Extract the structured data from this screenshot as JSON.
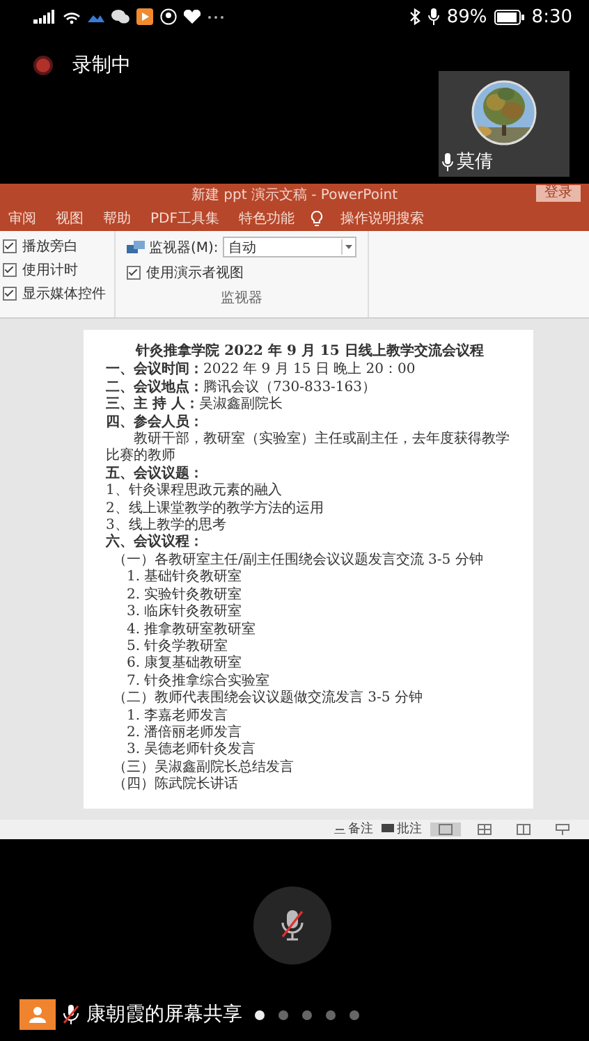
{
  "status_bar": {
    "battery": "89%",
    "time": "8:30"
  },
  "recording": {
    "label": "录制中",
    "on": true
  },
  "participant": {
    "name": "莫倩",
    "mic_on": true
  },
  "shared_screen": {
    "window_title": "新建 ppt 演示文稿  -  PowerPoint",
    "login_button": "登录",
    "ribbon_tabs": [
      {
        "label": "审阅",
        "selected": false
      },
      {
        "label": "视图",
        "selected": false
      },
      {
        "label": "帮助",
        "selected": false
      },
      {
        "label": "PDF工具集",
        "selected": false
      },
      {
        "label": "特色功能",
        "selected": false
      }
    ],
    "search_hint": "操作说明搜索",
    "options": [
      {
        "label": "播放旁白",
        "checked": true
      },
      {
        "label": "使用计时",
        "checked": true
      },
      {
        "label": "显示媒体控件",
        "checked": true
      }
    ],
    "monitor": {
      "label": "监视器(M):",
      "value": "自动",
      "presenter_view": {
        "label": "使用演示者视图",
        "checked": true
      },
      "group_label": "监视器"
    },
    "document": {
      "title": "针灸推拿学院 2022 年 9 月 15 日线上教学交流会议程",
      "lines": [
        {
          "kind": "item",
          "text": "**一、会议时间：**2022 年 9 月 15 日 晚上 20：00"
        },
        {
          "kind": "item",
          "text": "**二、会议地点：**腾讯会议（730-833-163）"
        },
        {
          "kind": "item",
          "text": "**三、主 持 人：**吴淑鑫副院长"
        },
        {
          "kind": "item",
          "text": "**四、参会人员：**"
        },
        {
          "kind": "para",
          "text": "教研干部，教研室（实验室）主任或副主任，去年度获得教学比赛的教师"
        },
        {
          "kind": "item",
          "text": "**五、会议议题：**"
        },
        {
          "kind": "item",
          "text": "1、针灸课程思政元素的融入"
        },
        {
          "kind": "item",
          "text": "2、线上课堂教学的教学方法的运用"
        },
        {
          "kind": "item",
          "text": "3、线上教学的思考"
        },
        {
          "kind": "item",
          "text": "**六、会议议程：**"
        },
        {
          "kind": "sub",
          "text": "（一）各教研室主任/副主任围绕会议议题发言交流 3-5 分钟"
        },
        {
          "kind": "indent",
          "text": "1. 基础针灸教研室"
        },
        {
          "kind": "indent",
          "text": "2. 实验针灸教研室"
        },
        {
          "kind": "indent",
          "text": "3. 临床针灸教研室"
        },
        {
          "kind": "indent",
          "text": "4. 推拿教研室教研室"
        },
        {
          "kind": "indent",
          "text": "5. 针灸学教研室"
        },
        {
          "kind": "indent",
          "text": "6. 康复基础教研室"
        },
        {
          "kind": "indent",
          "text": "7. 针灸推拿综合实验室"
        },
        {
          "kind": "sub",
          "text": "（二）教师代表围绕会议议题做交流发言 3-5 分钟"
        },
        {
          "kind": "indent",
          "text": "1. 李嘉老师发言"
        },
        {
          "kind": "indent",
          "text": "2. 潘倍丽老师发言"
        },
        {
          "kind": "indent",
          "text": "3. 吴德老师针灸发言"
        },
        {
          "kind": "sub",
          "text": "（三）吴淑鑫副院长总结发言"
        },
        {
          "kind": "sub",
          "text": "（四）陈武院长讲话"
        }
      ]
    },
    "status_buttons": [
      {
        "kind": "notes",
        "label": "备注"
      },
      {
        "kind": "comments",
        "label": "批注"
      }
    ]
  },
  "mic_button": {
    "muted": true
  },
  "presenter": {
    "label": "康朝霞的屏幕共享",
    "muted": true
  },
  "pages": [
    {
      "selected": true
    },
    {
      "selected": false
    },
    {
      "selected": false
    },
    {
      "selected": false
    },
    {
      "selected": false
    }
  ]
}
